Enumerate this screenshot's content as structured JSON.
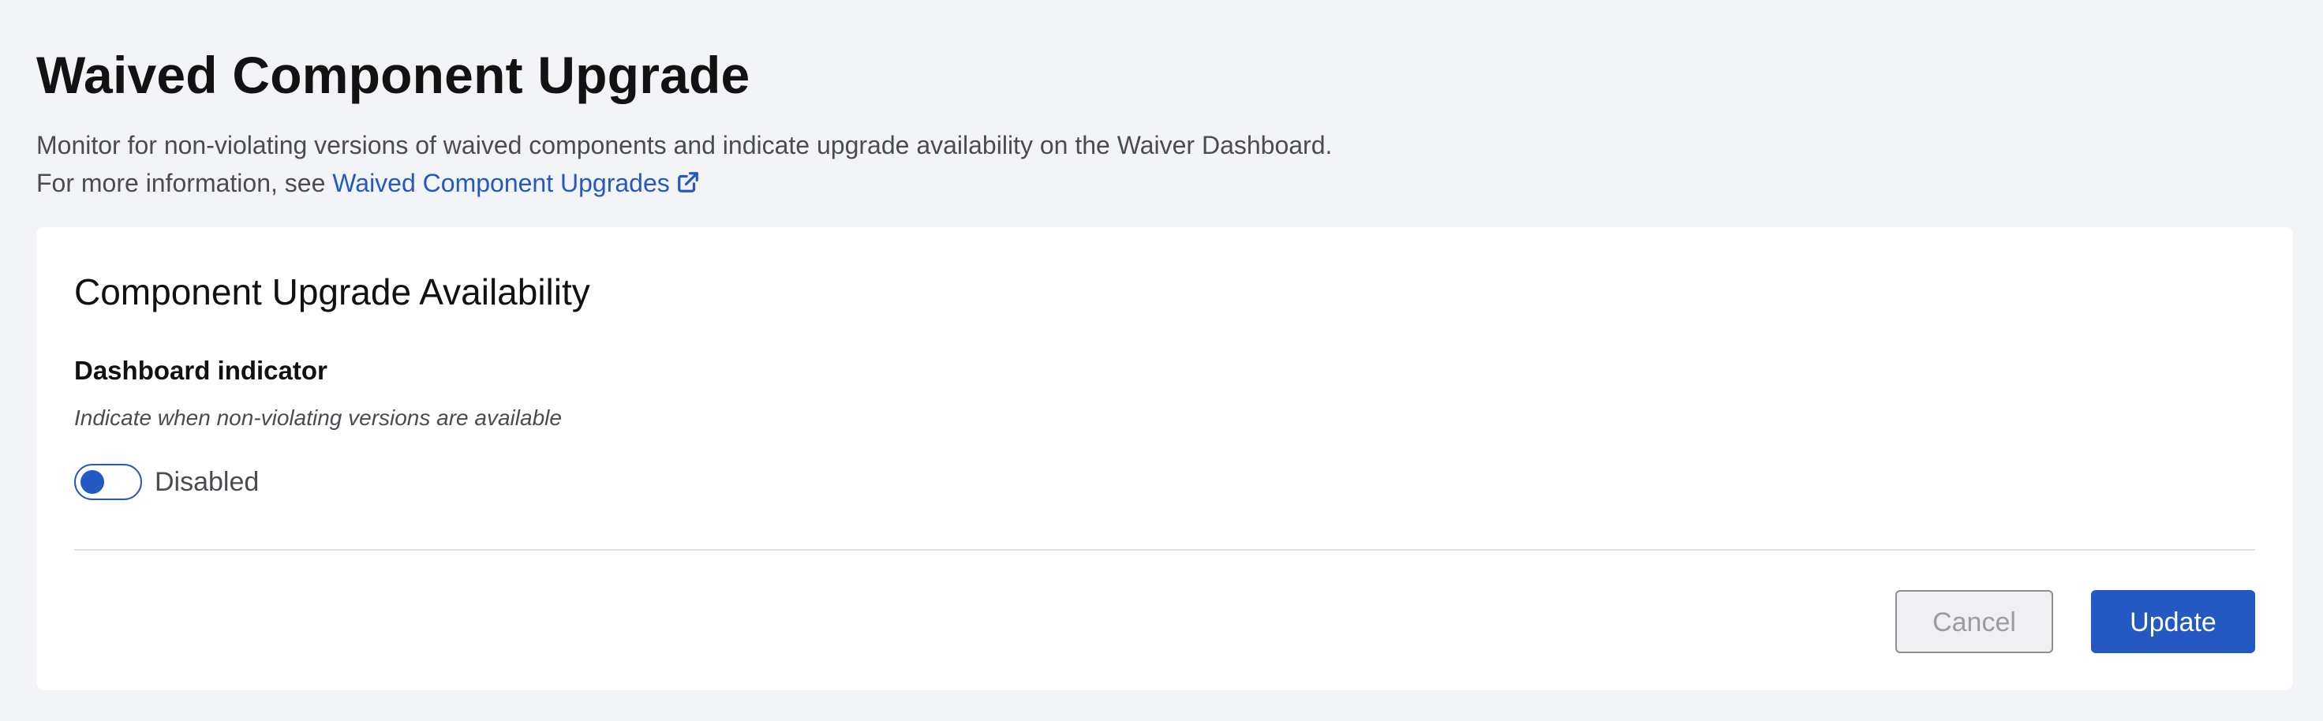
{
  "header": {
    "title": "Waived Component Upgrade",
    "description": "Monitor for non-violating versions of waived components and indicate upgrade availability on the Waiver Dashboard. For more information, see",
    "link_label": "Waived Component Upgrades",
    "link_icon": "external-link-icon"
  },
  "card": {
    "title": "Component Upgrade Availability",
    "field_label": "Dashboard indicator",
    "field_help": "Indicate when non-violating versions are available",
    "toggle": {
      "state_label": "Disabled",
      "enabled": false
    }
  },
  "actions": {
    "cancel_label": "Cancel",
    "update_label": "Update"
  },
  "colors": {
    "accent": "#2459c4",
    "background": "#f3f4f8",
    "card": "#ffffff"
  }
}
